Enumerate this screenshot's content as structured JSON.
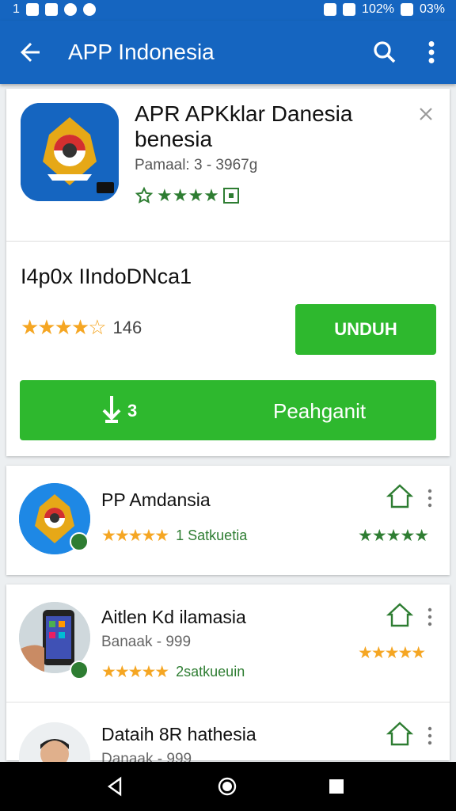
{
  "status_bar": {
    "left_text": "1",
    "right_text_1": "102%",
    "right_text_2": "03%"
  },
  "app_bar": {
    "title": "APP Indonesia",
    "back_icon": "arrow-left-icon",
    "search_icon": "search-icon",
    "more_icon": "more-vert-icon"
  },
  "main_app": {
    "name": "APR APKklar Danesia benesia",
    "meta": "Pamaal: 3 - 3967g",
    "subtitle": "I4p0x IIndoDNca1",
    "rating_count": "146",
    "install_label": "UNDUH",
    "big_button_count": "3",
    "big_button_label": "Peahganit",
    "colors": {
      "primary": "#1565c0",
      "install": "#2eb82e",
      "star": "#f5a623",
      "green": "#2e7d32"
    }
  },
  "list": [
    {
      "title": "PP Amdansia",
      "sub": "",
      "tag": "1 Satkuetia"
    },
    {
      "title": "Aitlen Kd ilamasia",
      "sub": "Banaak - 999",
      "tag": "2satkueuin"
    },
    {
      "title": "Dataih 8R hathesia",
      "sub": "Danaak - 999",
      "tag": ""
    }
  ],
  "nav_bar": {
    "back": "triangle-back-icon",
    "home": "circle-home-icon",
    "recents": "square-recents-icon"
  }
}
